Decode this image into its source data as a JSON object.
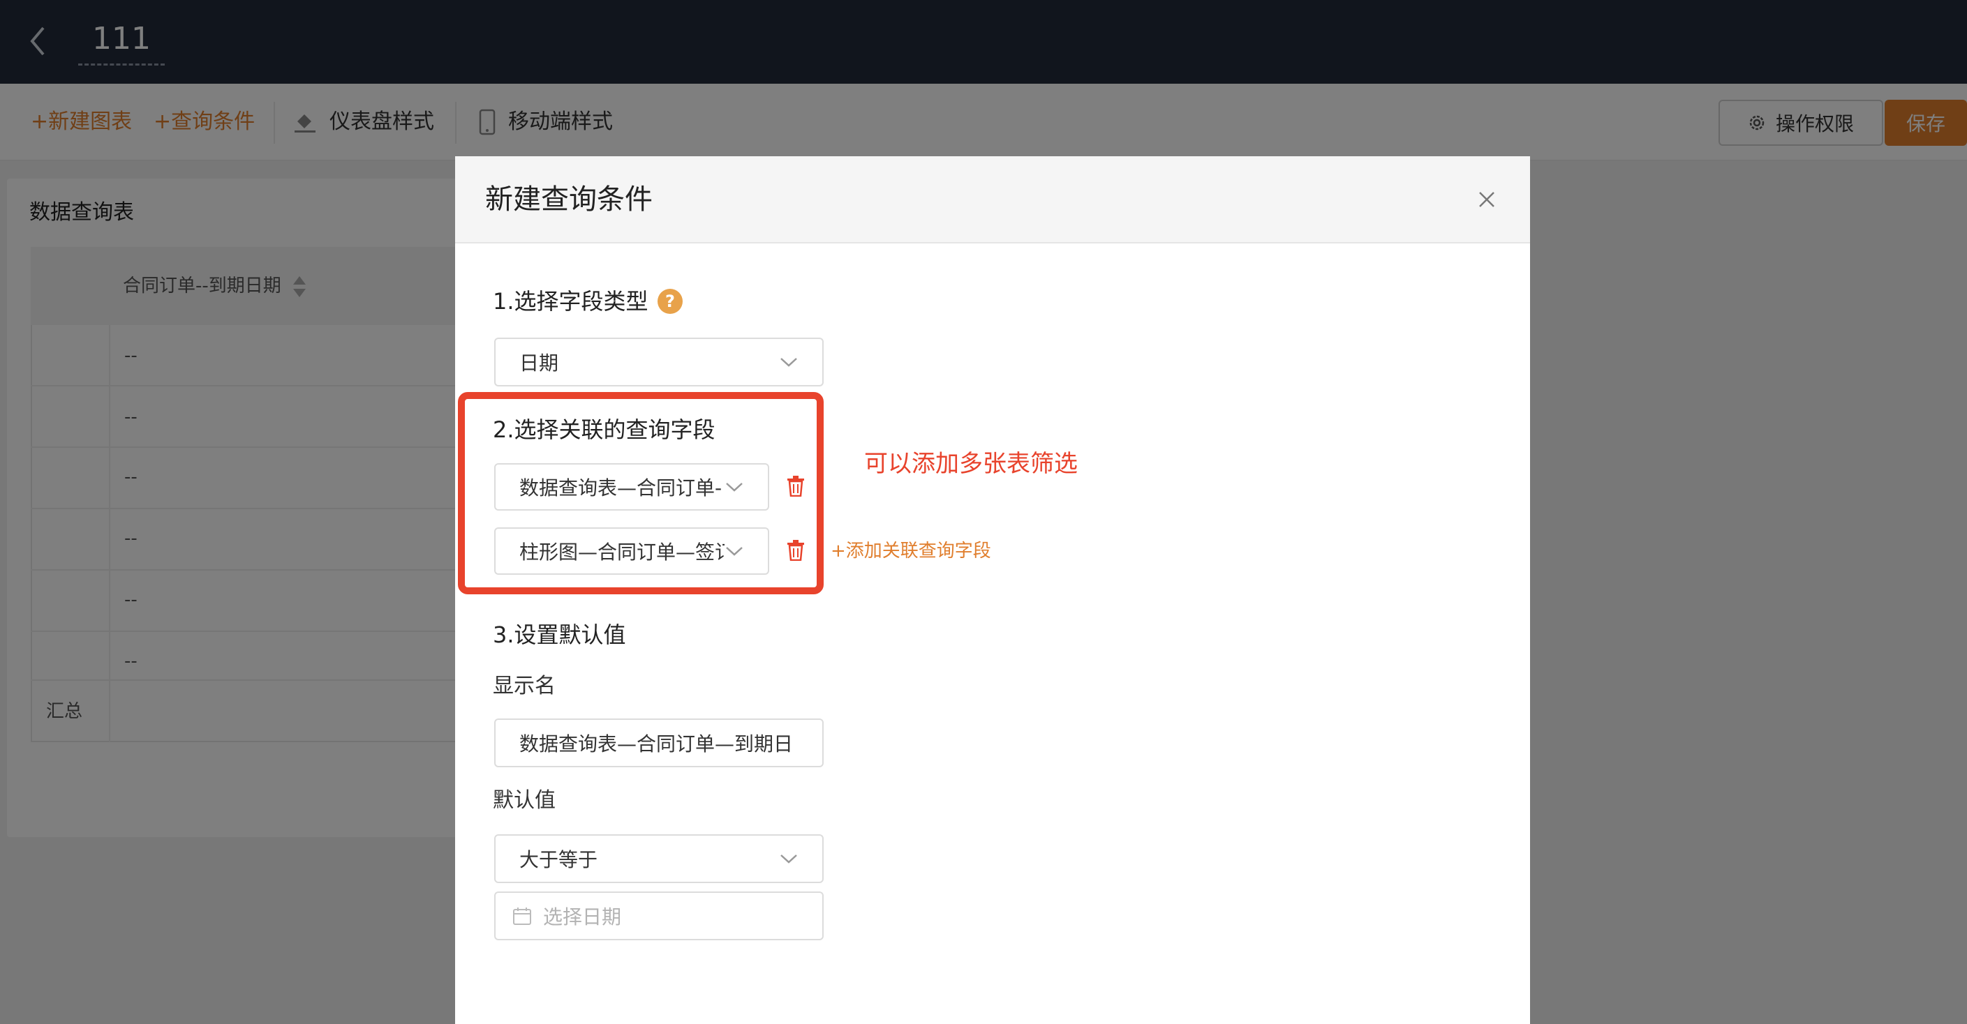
{
  "header": {
    "title": "111"
  },
  "toolbar": {
    "new_chart": "+新建图表",
    "query_condition": "+查询条件",
    "dashboard_style": "仪表盘样式",
    "mobile_style": "移动端样式",
    "permission": "操作权限",
    "save": "保存"
  },
  "card": {
    "title": "数据查询表",
    "column_header": "合同订单--到期日期",
    "rows": [
      "--",
      "--",
      "--",
      "--",
      "--",
      "--"
    ],
    "total_label": "汇总"
  },
  "modal": {
    "title": "新建查询条件",
    "step1_label": "1.选择字段类型",
    "help_glyph": "?",
    "field_type": "日期",
    "step2_label": "2.选择关联的查询字段",
    "related_fields": [
      "数据查询表—合同订单-",
      "柱形图—合同订单—签订"
    ],
    "add_related": "+添加关联查询字段",
    "annotation": "可以添加多张表筛选",
    "step3_label": "3.设置默认值",
    "display_name_label": "显示名",
    "display_name_value": "数据查询表—合同订单—到期日",
    "default_label": "默认值",
    "operator": "大于等于",
    "date_placeholder": "选择日期"
  },
  "colors": {
    "accent": "#e07e2d",
    "annotation_red": "#e8432c",
    "header_bg": "#232b3a"
  }
}
